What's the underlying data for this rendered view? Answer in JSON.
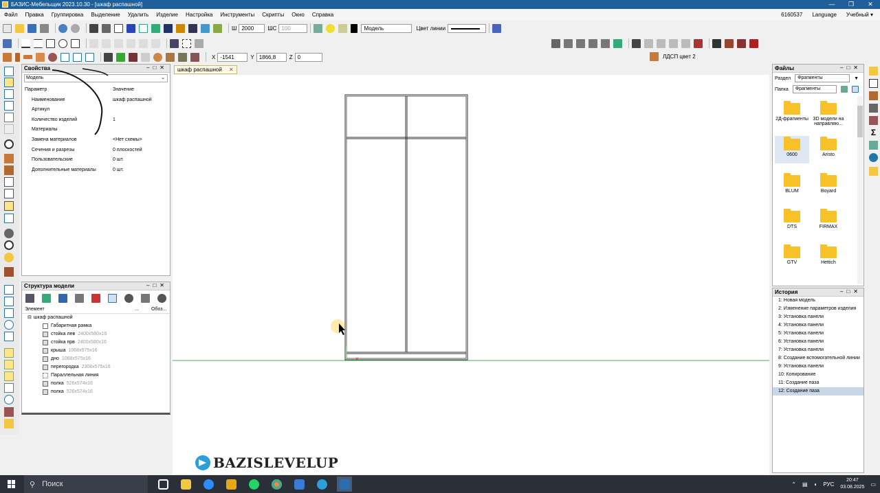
{
  "window": {
    "title": "БАЗИС-Мебельщик 2023.10.30 - [шкаф распашной]",
    "controls": [
      "—",
      "❐",
      "✕"
    ]
  },
  "menu": {
    "items": [
      "Файл",
      "Правка",
      "Группировка",
      "Выделение",
      "Удалить",
      "Изделие",
      "Настройка",
      "Инструменты",
      "Скрипты",
      "Окно",
      "Справка"
    ],
    "right": [
      "6160537",
      "Language",
      "Учебный ▾"
    ]
  },
  "toolbar": {
    "sh_label": "Ш",
    "sh_value": "2000",
    "shc_label": "ШС",
    "shc_value": "100",
    "layer_value": "Модель",
    "line_color_label": "Цвет линии",
    "x_label": "X",
    "x_value": "-1541",
    "y_label": "Y",
    "y_value": "1866,8",
    "z_label": "Z",
    "z_value": "0",
    "material_label": "ЛДСП цвет 2"
  },
  "properties": {
    "title": "Свойства",
    "select": "Модель",
    "col_param": "Параметр",
    "col_value": "Значение",
    "rows": [
      {
        "k": "Наименование",
        "v": "шкаф распашной"
      },
      {
        "k": "Артикул",
        "v": ""
      },
      {
        "k": "Количество изделий",
        "v": "1"
      },
      {
        "k": "Материалы",
        "v": ""
      },
      {
        "k": "Замена материалов",
        "v": "<Нет схемы>"
      },
      {
        "k": "Сечения и разрезы",
        "v": "0 плоскостей"
      },
      {
        "k": "Пользовательские",
        "v": "0 шт."
      },
      {
        "k": "Дополнительные материалы",
        "v": "0 шт."
      }
    ]
  },
  "structure": {
    "title": "Структура модели",
    "col_element": "Элемент",
    "col_more": "...",
    "col_designation": "Обоз...",
    "root": "шкаф распашной",
    "items": [
      {
        "name": "Габаритная рамка",
        "size": ""
      },
      {
        "name": "стойка лев",
        "size": "2400x580x16"
      },
      {
        "name": "стойка прв",
        "size": "2400x580x16"
      },
      {
        "name": "крыша",
        "size": "1068x575x16"
      },
      {
        "name": "дно",
        "size": "1068x575x16"
      },
      {
        "name": "перегородка",
        "size": "2308x575x16"
      },
      {
        "name": "Параллельная линия",
        "size": ""
      },
      {
        "name": "полка",
        "size": "526x574x16"
      },
      {
        "name": "полка",
        "size": "526x574x16"
      }
    ]
  },
  "document_tab": {
    "label": "шкаф распашной",
    "close": "✕"
  },
  "files": {
    "title": "Файлы",
    "section_label": "Раздел",
    "section_value": "Фрагменты",
    "folder_label": "Папка",
    "folder_value": "Фрагменты",
    "items": [
      "2Д-фрагменты",
      "3D модели на направляю...",
      "0600",
      "Aristo",
      "BLUM",
      "Boyard",
      "DTS",
      "FIRMAX",
      "GTV",
      "Hettich"
    ]
  },
  "history": {
    "title": "История",
    "items": [
      "1:  Новая модель",
      "2:  Изменение параметров изделия",
      "3:  Установка панели",
      "4:  Установка панели",
      "5:  Установка панели",
      "6:  Установка панели",
      "7:  Установка панели",
      "8:  Создание вспомогательной линии",
      "9:  Установка панели",
      "10:  Копирование",
      "11:  Создание паза",
      "12:  Создание паза"
    ]
  },
  "watermark": "BAZISLEVELUP",
  "taskbar": {
    "search": "Поиск",
    "lang": "РУС",
    "time": "20:47",
    "date": "03.08.2025"
  },
  "colors": {
    "titlebar": "#1f5f9a",
    "folder": "#f7c12a",
    "history_selected": "#c8d6e6",
    "tab": "#fffbe6",
    "ground_line": "#3cb84a"
  }
}
